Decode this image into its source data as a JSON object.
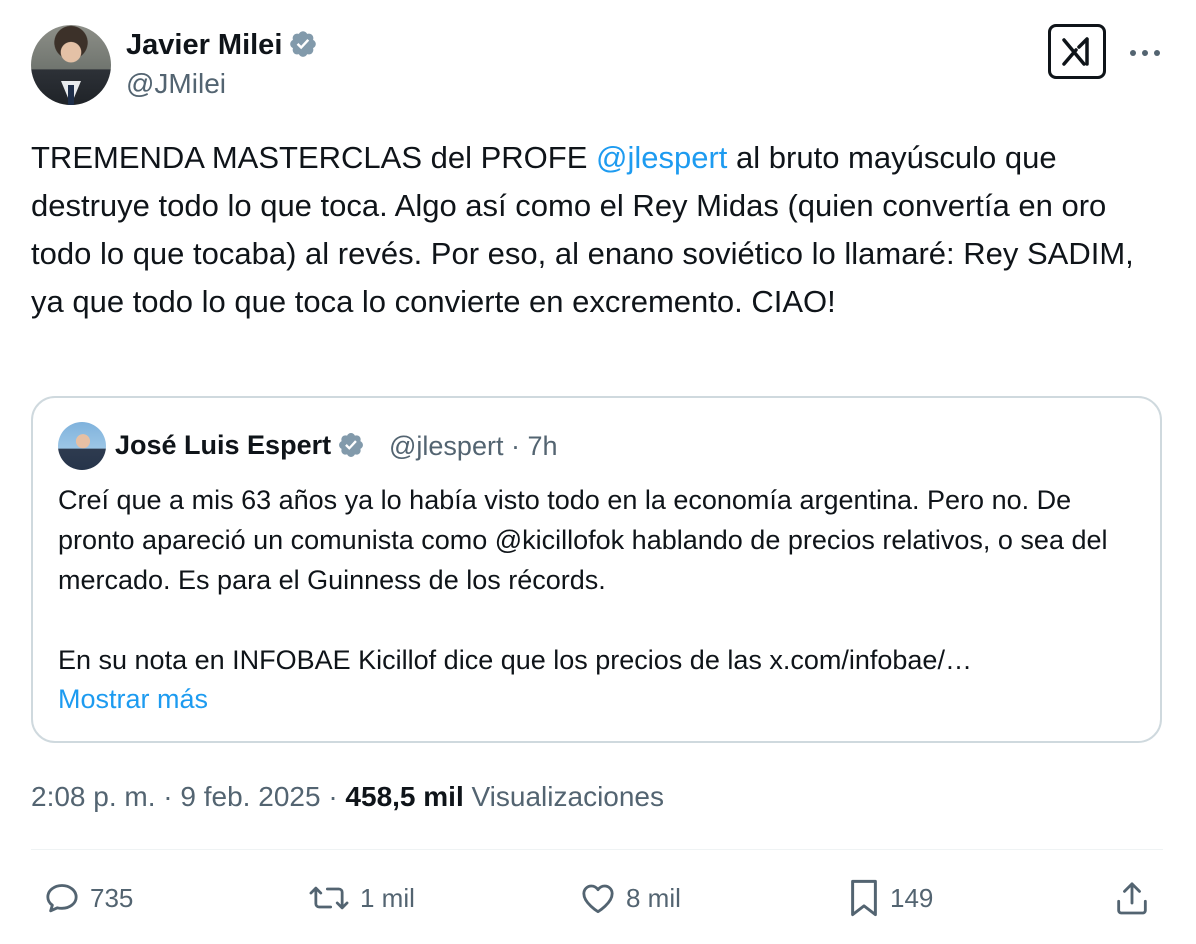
{
  "author": {
    "name": "Javier Milei",
    "handle": "@JMilei"
  },
  "tweet": {
    "text_1": "TREMENDA MASTERCLAS del PROFE ",
    "mention": "@jlespert",
    "text_2": " al bruto mayúsculo que destruye todo lo que toca. Algo así como el Rey Midas (quien convertía en oro todo lo que tocaba) al revés. Por eso, al enano soviético lo llamaré: Rey SADIM, ya que todo lo que toca lo convierte en excremento. CIAO!"
  },
  "quote": {
    "name": "José Luis Espert",
    "handle": "@jlespert",
    "separator": "·",
    "age": "7h",
    "text_1": "Creí que a mis 63 años ya lo había visto todo en la economía argentina. Pero no. De pronto apareció un comunista como @kicillofok hablando de precios relativos, o sea del mercado. Es para el Guinness de los récords.",
    "text_2": "En su nota en INFOBAE Kicillof dice que los precios de las x.com/infobae/…",
    "show_more": "Mostrar más"
  },
  "meta": {
    "time": "2:08 p. m.",
    "dot_1": "·",
    "date": "9 feb. 2025",
    "dot_2": "·",
    "views": "458,5 mil",
    "views_label": "Visualizaciones"
  },
  "actions": {
    "replies": "735",
    "reposts": "1 mil",
    "likes": "8 mil",
    "bookmarks": "149"
  },
  "colors": {
    "accent": "#1d9bf0",
    "text": "#0f1419",
    "muted": "#536471",
    "border": "#cfd9de"
  },
  "icons": {
    "verified": "verified-badge-icon",
    "grok": "grok-icon",
    "more": "more-dots-icon",
    "reply": "reply-icon",
    "repost": "repost-icon",
    "like": "heart-icon",
    "bookmark": "bookmark-icon",
    "share": "share-icon"
  }
}
